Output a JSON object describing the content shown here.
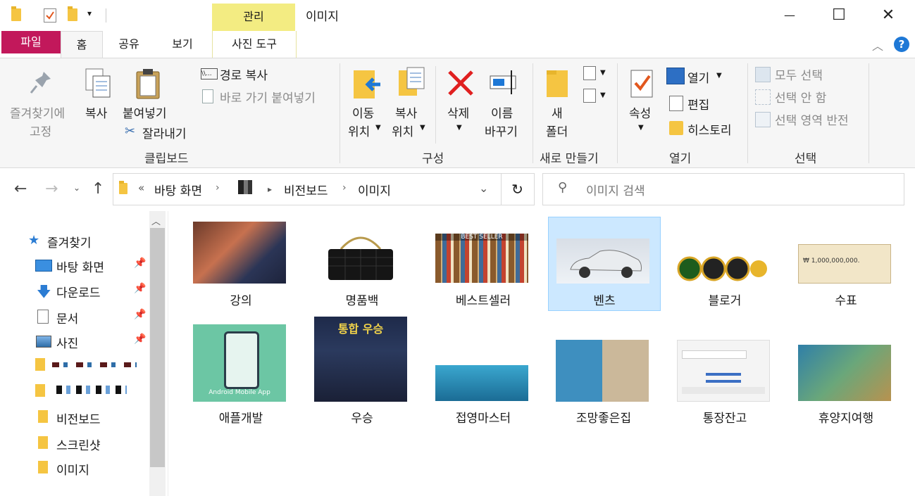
{
  "window": {
    "title": "이미지",
    "context_tab": "관리",
    "controls": {
      "minimize": "—",
      "maximize": "☐",
      "close": "✕"
    }
  },
  "ribbon_tabs": [
    "파일",
    "홈",
    "공유",
    "보기",
    "사진 도구"
  ],
  "ribbon": {
    "clipboard": {
      "pin_label_1": "즐겨찾기에",
      "pin_label_2": "고정",
      "copy": "복사",
      "paste": "붙여넣기",
      "copy_path": "경로 복사",
      "paste_shortcut": "바로 가기 붙여넣기",
      "cut": "잘라내기",
      "group": "클립보드"
    },
    "organize": {
      "move_1": "이동",
      "move_2": "위치",
      "copy_1": "복사",
      "copy_2": "위치",
      "delete": "삭제",
      "rename_1": "이름",
      "rename_2": "바꾸기",
      "group": "구성"
    },
    "new": {
      "folder_1": "새",
      "folder_2": "폴더",
      "group": "새로 만들기"
    },
    "open": {
      "properties": "속성",
      "open": "열기",
      "edit": "편집",
      "history": "히스토리",
      "group": "열기"
    },
    "select": {
      "all": "모두 선택",
      "none": "선택 안 함",
      "invert": "선택 영역 반전",
      "group": "선택"
    }
  },
  "address": {
    "prefix": "«",
    "crumbs": [
      "바탕 화면",
      "비전보드",
      "이미지"
    ],
    "search_placeholder": "이미지 검색"
  },
  "nav": {
    "quick_access": "즐겨찾기",
    "items": [
      {
        "label": "바탕 화면",
        "pinned": true,
        "icon": "desktop-icon"
      },
      {
        "label": "다운로드",
        "pinned": true,
        "icon": "download-icon"
      },
      {
        "label": "문서",
        "pinned": true,
        "icon": "document-icon"
      },
      {
        "label": "사진",
        "pinned": true,
        "icon": "picture-icon"
      },
      {
        "label": "비전보드",
        "pinned": false,
        "icon": "folder-icon"
      },
      {
        "label": "스크린샷",
        "pinned": false,
        "icon": "folder-icon"
      },
      {
        "label": "이미지",
        "pinned": false,
        "icon": "folder-icon"
      }
    ]
  },
  "files": [
    {
      "name": "강의",
      "selected": false
    },
    {
      "name": "명품백",
      "selected": false
    },
    {
      "name": "베스트셀러",
      "selected": false,
      "thumb_text": "BEST SELLER"
    },
    {
      "name": "벤츠",
      "selected": true
    },
    {
      "name": "블로거",
      "selected": false
    },
    {
      "name": "수표",
      "selected": false,
      "thumb_text": "₩ 1,000,000,000."
    },
    {
      "name": "애플개발",
      "selected": false,
      "thumb_text": "Android Mobile App"
    },
    {
      "name": "우승",
      "selected": false,
      "thumb_text": "통합 우승"
    },
    {
      "name": "접영마스터",
      "selected": false
    },
    {
      "name": "조망좋은집",
      "selected": false
    },
    {
      "name": "통장잔고",
      "selected": false
    },
    {
      "name": "휴양지여행",
      "selected": false
    }
  ]
}
